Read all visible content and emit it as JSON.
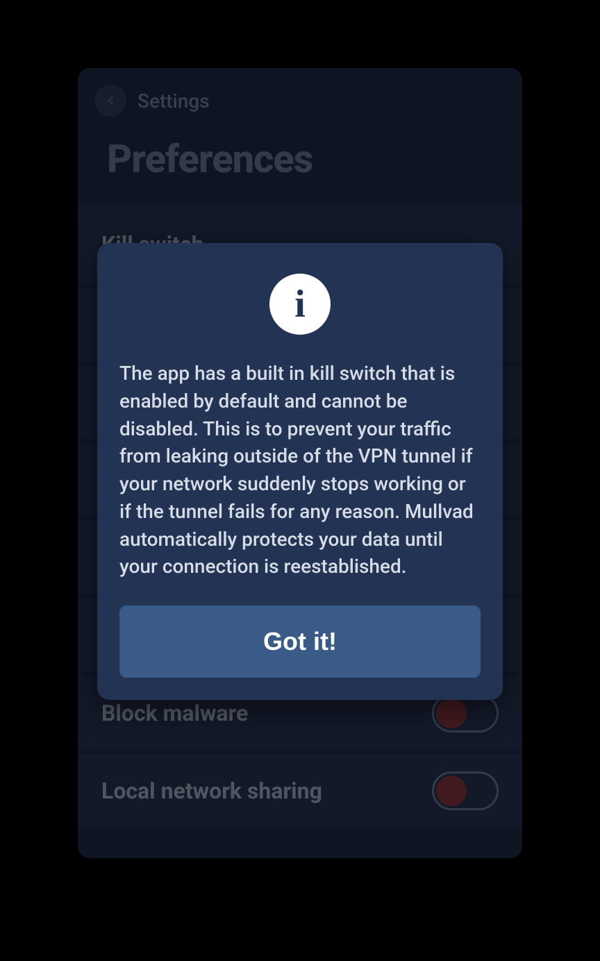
{
  "header": {
    "back_label": "Settings",
    "title": "Preferences"
  },
  "rows": {
    "kill_switch": "Kill switch",
    "block_malware": "Block malware",
    "local_network_sharing": "Local network sharing"
  },
  "modal": {
    "text": "The app has a built in kill switch that is enabled by default and cannot be disabled. This is to prevent your traffic from leaking outside of the VPN tunnel if your network suddenly stops working or if the tunnel fails for any reason. Mullvad automatically protects your data until your connection is reestablished.",
    "button": "Got it!"
  }
}
